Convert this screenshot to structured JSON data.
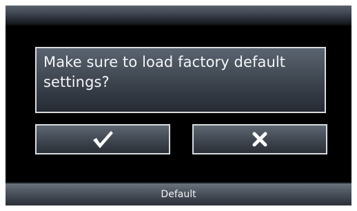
{
  "dialog": {
    "message": "Make sure to load factory default settings?"
  },
  "buttons": {
    "confirm_icon": "checkmark-icon",
    "cancel_icon": "close-x-icon"
  },
  "footer": {
    "title": "Default"
  }
}
